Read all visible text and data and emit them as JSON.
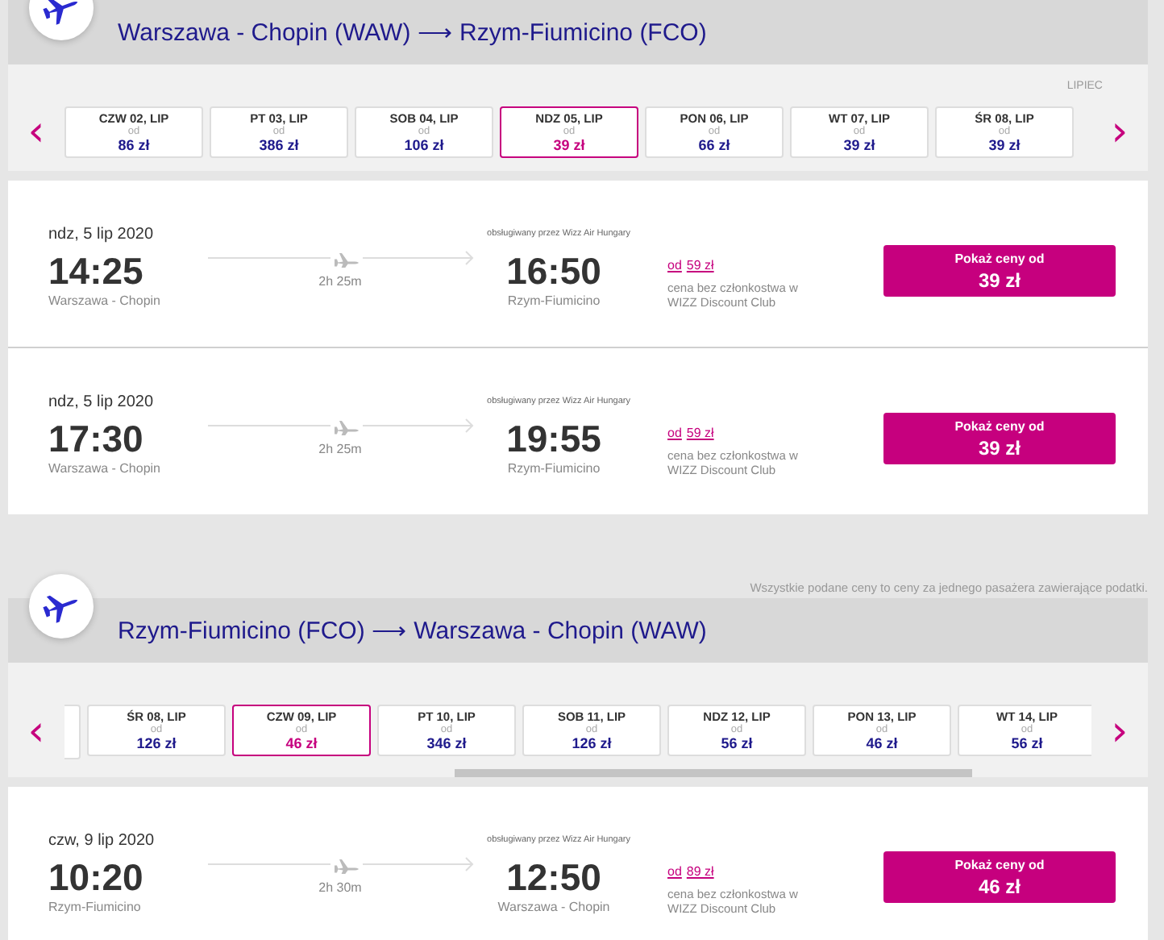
{
  "sections": [
    {
      "from": "Warszawa - Chopin (WAW)",
      "to": "Rzym-Fiumicino (FCO)",
      "arrow": "⟶",
      "month": "LIPIEC",
      "partial_card_before": false,
      "scrollbar": false,
      "prev": "‹",
      "next": "›",
      "days": [
        {
          "day": "CZW 02, LIP",
          "od": "od",
          "price": "86 zł",
          "selected": false
        },
        {
          "day": "PT 03, LIP",
          "od": "od",
          "price": "386 zł",
          "selected": false
        },
        {
          "day": "SOB 04, LIP",
          "od": "od",
          "price": "106 zł",
          "selected": false
        },
        {
          "day": "NDZ 05, LIP",
          "od": "od",
          "price": "39 zł",
          "selected": true
        },
        {
          "day": "PON 06, LIP",
          "od": "od",
          "price": "66 zł",
          "selected": false
        },
        {
          "day": "WT 07, LIP",
          "od": "od",
          "price": "39 zł",
          "selected": false
        },
        {
          "day": "ŚR 08, LIP",
          "od": "od",
          "price": "39 zł",
          "selected": false
        }
      ],
      "flights": [
        {
          "date": "ndz, 5 lip 2020",
          "dep_time": "14:25",
          "dep_airport": "Warszawa - Chopin",
          "duration": "2h 25m",
          "operator": "obsługiwany przez Wizz Air Hungary",
          "arr_time": "16:50",
          "arr_airport": "Rzym-Fiumicino",
          "od": "od",
          "member_price": "59 zł",
          "note": "cena bez członkostwa w WIZZ Discount Club",
          "button_label": "Pokaż ceny od",
          "button_price": "39 zł"
        },
        {
          "date": "ndz, 5 lip 2020",
          "dep_time": "17:30",
          "dep_airport": "Warszawa - Chopin",
          "duration": "2h 25m",
          "operator": "obsługiwany przez Wizz Air Hungary",
          "arr_time": "19:55",
          "arr_airport": "Rzym-Fiumicino",
          "od": "od",
          "member_price": "59 zł",
          "note": "cena bez członkostwa w WIZZ Discount Club",
          "button_label": "Pokaż ceny od",
          "button_price": "39 zł"
        }
      ]
    },
    {
      "notice": "Wszystkie podane ceny to ceny za jednego pasażera zawierające podatki.",
      "from": "Rzym-Fiumicino (FCO)",
      "to": "Warszawa - Chopin (WAW)",
      "arrow": "⟶",
      "partial_card_before": true,
      "scrollbar": true,
      "prev": "‹",
      "next": "›",
      "days": [
        {
          "day": "ŚR 08, LIP",
          "od": "od",
          "price": "126 zł",
          "selected": false
        },
        {
          "day": "CZW 09, LIP",
          "od": "od",
          "price": "46 zł",
          "selected": true
        },
        {
          "day": "PT 10, LIP",
          "od": "od",
          "price": "346 zł",
          "selected": false
        },
        {
          "day": "SOB 11, LIP",
          "od": "od",
          "price": "126 zł",
          "selected": false
        },
        {
          "day": "NDZ 12, LIP",
          "od": "od",
          "price": "56 zł",
          "selected": false
        },
        {
          "day": "PON 13, LIP",
          "od": "od",
          "price": "46 zł",
          "selected": false
        },
        {
          "day": "WT 14, LIP",
          "od": "od",
          "price": "56 zł",
          "selected": false
        }
      ],
      "flights": [
        {
          "date": "czw, 9 lip 2020",
          "dep_time": "10:20",
          "dep_airport": "Rzym-Fiumicino",
          "duration": "2h 30m",
          "operator": "obsługiwany przez Wizz Air Hungary",
          "arr_time": "12:50",
          "arr_airport": "Warszawa - Chopin",
          "od": "od",
          "member_price": "89 zł",
          "note": "cena bez członkostwa w WIZZ Discount Club",
          "button_label": "Pokaż ceny od",
          "button_price": "46 zł"
        }
      ]
    }
  ]
}
